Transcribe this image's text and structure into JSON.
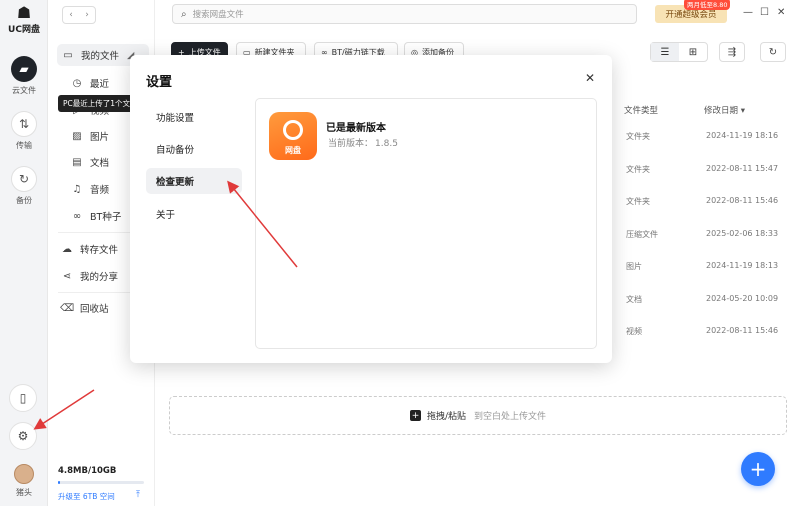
{
  "rail": {
    "logo_text": "UC网盘",
    "items": [
      {
        "label": "云文件",
        "icon": "folder-icon"
      },
      {
        "label": "传输",
        "icon": "transfer-icon"
      },
      {
        "label": "备份",
        "icon": "backup-icon"
      }
    ],
    "user_name": "猪头"
  },
  "sidebar": {
    "my_files": "我的文件",
    "recent": "最近",
    "tooltip": "PC最近上传了1个文件",
    "video": "视频",
    "image": "图片",
    "doc": "文档",
    "audio": "音频",
    "bt": "BT种子",
    "transfer_files": "转存文件",
    "my_share": "我的分享",
    "recycle": "回收站",
    "storage": "4.8MB/10GB",
    "storage_used_fraction": 0.02,
    "upgrade": "升级至 6TB 空间"
  },
  "topbar": {
    "search_placeholder": "搜索网盘文件",
    "vip_label": "开通超级会员",
    "vip_badge": "两月低至8.80"
  },
  "toolbar": {
    "upload": "上传文件",
    "new_folder": "新建文件夹",
    "bt_download": "BT/磁力链下载",
    "add_backup": "添加备份"
  },
  "table": {
    "col_type": "文件类型",
    "col_date": "修改日期",
    "rows": [
      {
        "type": "文件夹",
        "date": "2024-11-19 18:16"
      },
      {
        "type": "文件夹",
        "date": "2022-08-11 15:47"
      },
      {
        "type": "文件夹",
        "date": "2022-08-11 15:46"
      },
      {
        "type": "压缩文件",
        "date": "2025-02-06 18:33"
      },
      {
        "type": "图片",
        "date": "2024-11-19 18:13"
      },
      {
        "type": "文档",
        "date": "2024-05-20 10:09"
      },
      {
        "type": "视频",
        "date": "2022-08-11 15:46"
      }
    ]
  },
  "dropzone": {
    "label": "拖拽/粘贴",
    "hint": "到空白处上传文件"
  },
  "modal": {
    "title": "设置",
    "nav": [
      "功能设置",
      "自动备份",
      "检查更新",
      "关于"
    ],
    "active_index": 2,
    "update_title": "已是最新版本",
    "version_label": "当前版本：",
    "version": "1.8.5",
    "app_icon_label": "网盘"
  },
  "colors": {
    "accent": "#2f7bff",
    "dark": "#1f2329",
    "annotation": "#e03a3a"
  }
}
